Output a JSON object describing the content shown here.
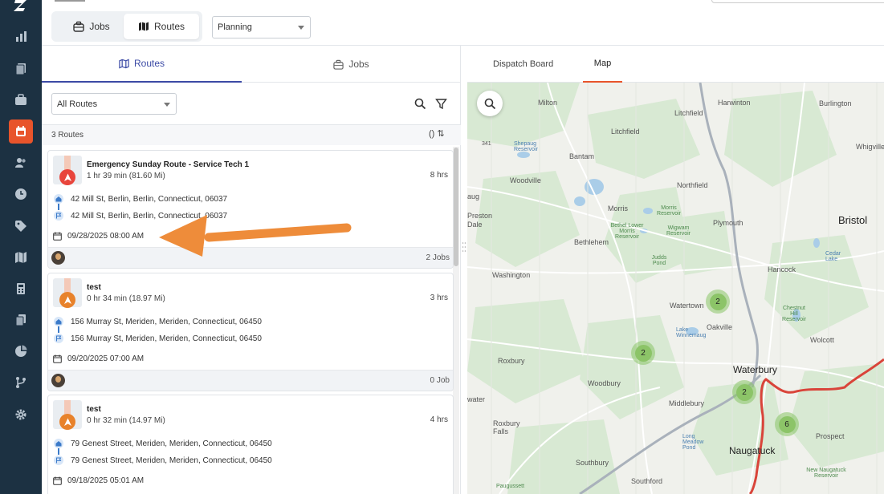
{
  "topbar": {
    "segment": [
      {
        "label": "Jobs",
        "icon": "briefcase-icon"
      },
      {
        "label": "Routes",
        "icon": "map-icon",
        "active": true
      }
    ],
    "view_select": "Planning"
  },
  "left_panel": {
    "tabs": [
      {
        "label": "Routes",
        "icon": "map-icon",
        "active": true
      },
      {
        "label": "Jobs",
        "icon": "briefcase-icon"
      }
    ],
    "filter_select": "All Routes",
    "route_count": "3 Routes",
    "sort_symbols": "() ⇅",
    "routes": [
      {
        "title": "Emergency Sunday Route - Service Tech 1",
        "summary": "1 hr 39 min (81.60 Mi)",
        "hours": "8 hrs",
        "start": "42 Mill St, Berlin, Berlin, Connecticut, 06037",
        "end": "42 Mill St, Berlin, Berlin, Connecticut, 06037",
        "date": "09/28/2025 08:00 AM",
        "jobs": "2 Jobs",
        "pin_color": "#e8453c"
      },
      {
        "title": "test",
        "summary": "0 hr 34 min (18.97 Mi)",
        "hours": "3 hrs",
        "start": "156 Murray St, Meriden, Meriden, Connecticut, 06450",
        "end": "156 Murray St, Meriden, Meriden, Connecticut, 06450",
        "date": "09/20/2025 07:00 AM",
        "jobs": "0 Job",
        "pin_color": "#e8822b"
      },
      {
        "title": "test",
        "summary": "0 hr 32 min (14.97 Mi)",
        "hours": "4 hrs",
        "start": "79 Genest Street, Meriden, Meriden, Connecticut, 06450",
        "end": "79 Genest Street, Meriden, Meriden, Connecticut, 06450",
        "date": "09/18/2025 05:01 AM",
        "pin_color": "#e8822b"
      }
    ]
  },
  "right_panel": {
    "tabs": [
      {
        "label": "Dispatch Board"
      },
      {
        "label": "Map",
        "active": true
      }
    ],
    "map": {
      "towns": [
        "Milton",
        "Harwinton",
        "Burlington",
        "Litchfield",
        "Bantam",
        "Woodville",
        "Northfield",
        "Morris",
        "Bristol",
        "Plymouth",
        "Bethlehem",
        "Washington",
        "Hancock",
        "Watertown",
        "Oakville",
        "Wolcott",
        "Waterbury",
        "Roxbury",
        "Woodbury",
        "Middlebury",
        "Naugatuck",
        "Prospect",
        "Southbury",
        "Southford",
        "Whigville",
        "Preston",
        "Dale",
        "Bristol"
      ],
      "small_labels": {
        "shepaug": "Shepaug Reservoir",
        "morris_res": "Morris Reservoir",
        "lower_morris": "Bethel Lower Morris Reservoir",
        "wigwam": "Wigwam Reservoir",
        "judds": "Judds Pond",
        "chestnut": "Chestnut Hill Reservoir",
        "lake_winnemaug": "Lake Winnemaug",
        "cedar_lake": "Cedar Lake",
        "long_meadow": "Long Meadow Pond",
        "roxbury_falls": "Roxbury Falls",
        "new_naugatuck": "New Naugatuck Reservoir",
        "paugussett": "Paugussett",
        "water": "water",
        "aug": "aug",
        "route_341": "341"
      },
      "clusters": [
        "2",
        "2",
        "2",
        "6"
      ]
    }
  },
  "colors": {
    "sidebar_bg": "#1c3142",
    "accent": "#e8542b",
    "tab_active": "#3b4aa5",
    "cluster": "#8cc468",
    "route_line": "#d9443a"
  }
}
